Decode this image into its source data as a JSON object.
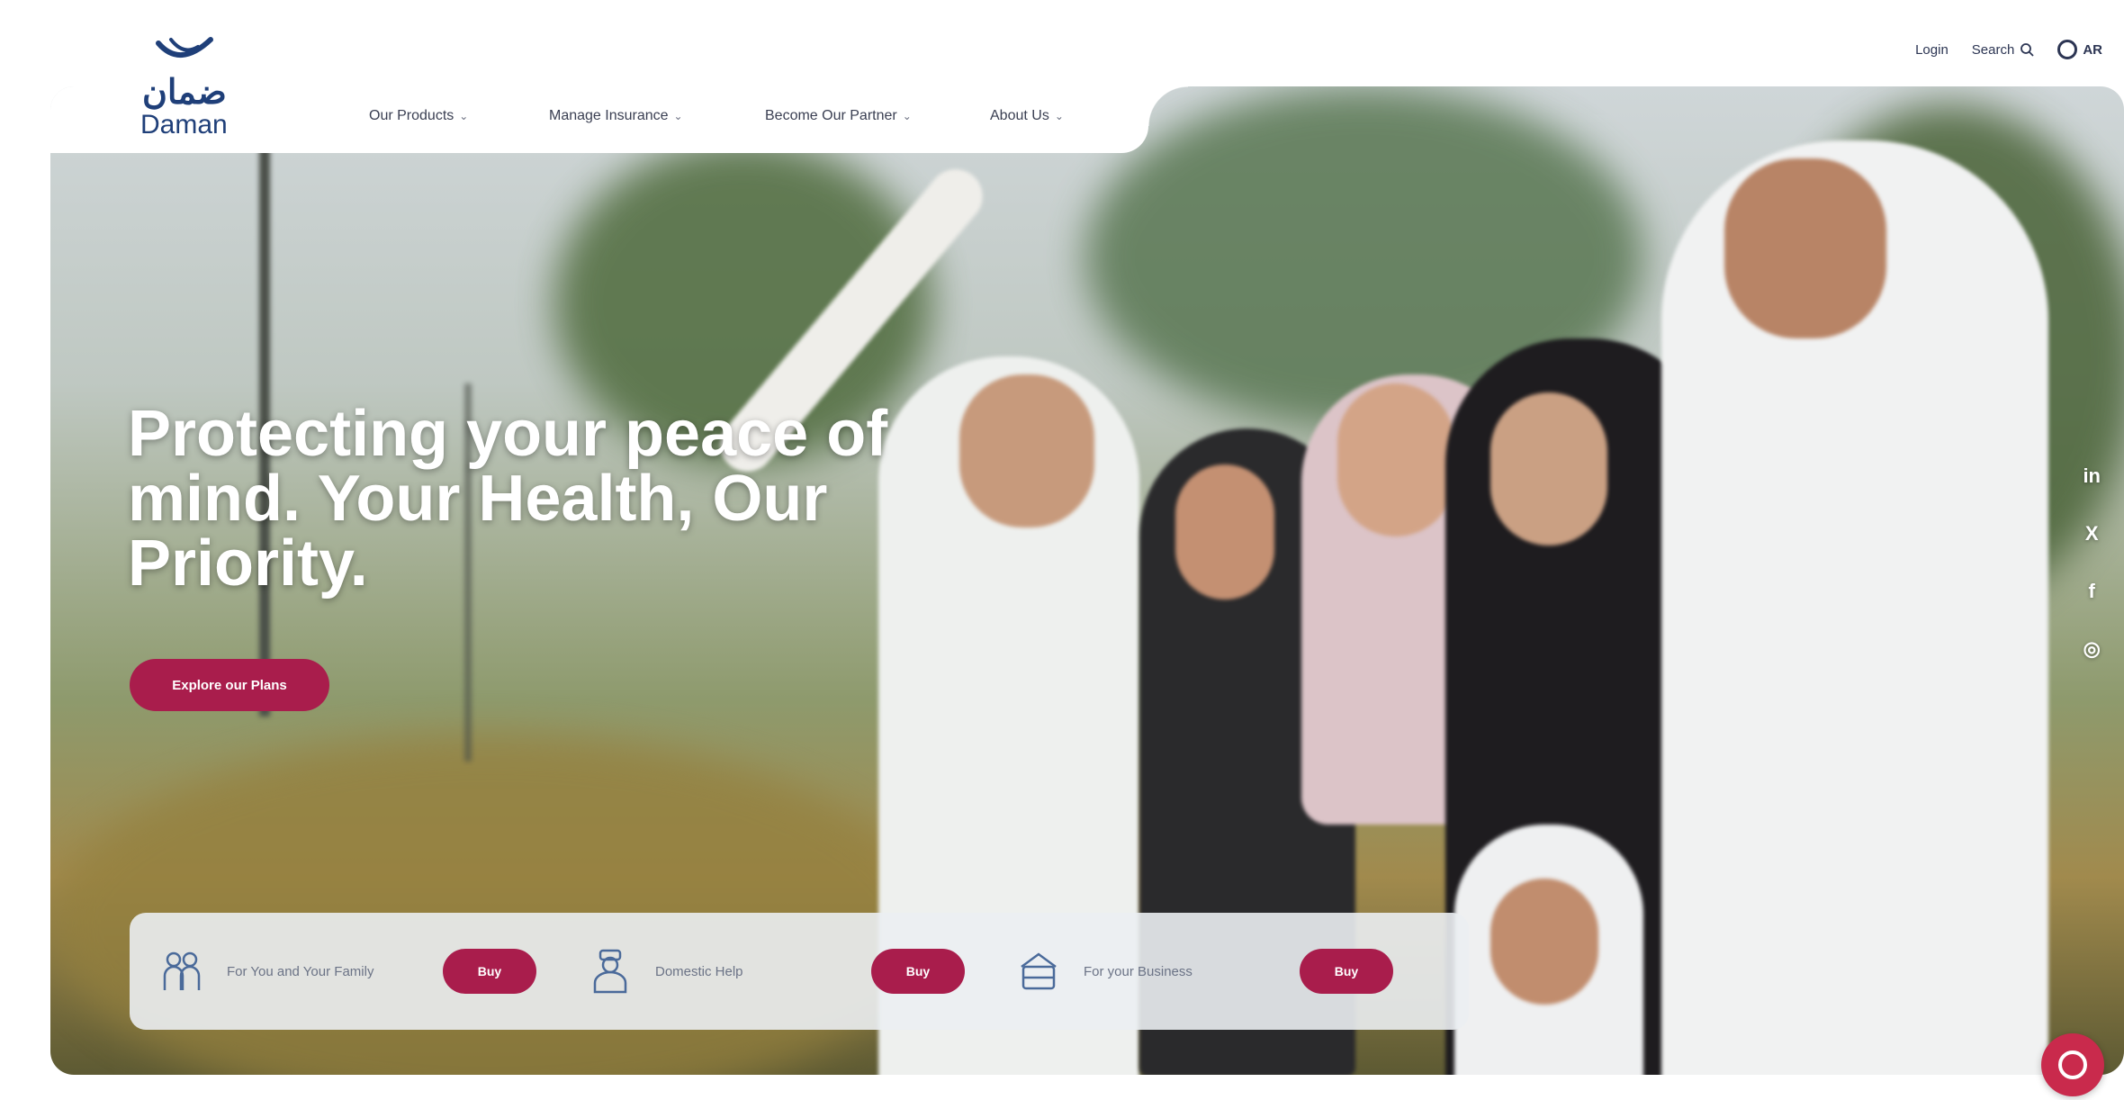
{
  "brand": {
    "logo_arabic": "ضمان",
    "logo_english": "Daman"
  },
  "nav": {
    "items": [
      {
        "label": "Our Products"
      },
      {
        "label": "Manage Insurance"
      },
      {
        "label": "Become Our Partner"
      },
      {
        "label": "About Us"
      }
    ]
  },
  "utility": {
    "login": "Login",
    "search": "Search",
    "language": "AR"
  },
  "hero": {
    "title": "Protecting your peace of mind. Your Health, Our Priority.",
    "cta": "Explore our Plans"
  },
  "quick_bar": {
    "items": [
      {
        "label": "For You and Your Family",
        "button": "Buy",
        "icon": "family-icon"
      },
      {
        "label": "Domestic Help",
        "button": "Buy",
        "icon": "domestic-helper-icon"
      },
      {
        "label": "For your Business",
        "button": "Buy",
        "icon": "business-icon"
      }
    ]
  },
  "social": {
    "linkedin": "in",
    "x": "X",
    "facebook": "f",
    "instagram": "◎"
  },
  "colors": {
    "accent": "#a91d4c",
    "brand_blue": "#1f3f79"
  }
}
